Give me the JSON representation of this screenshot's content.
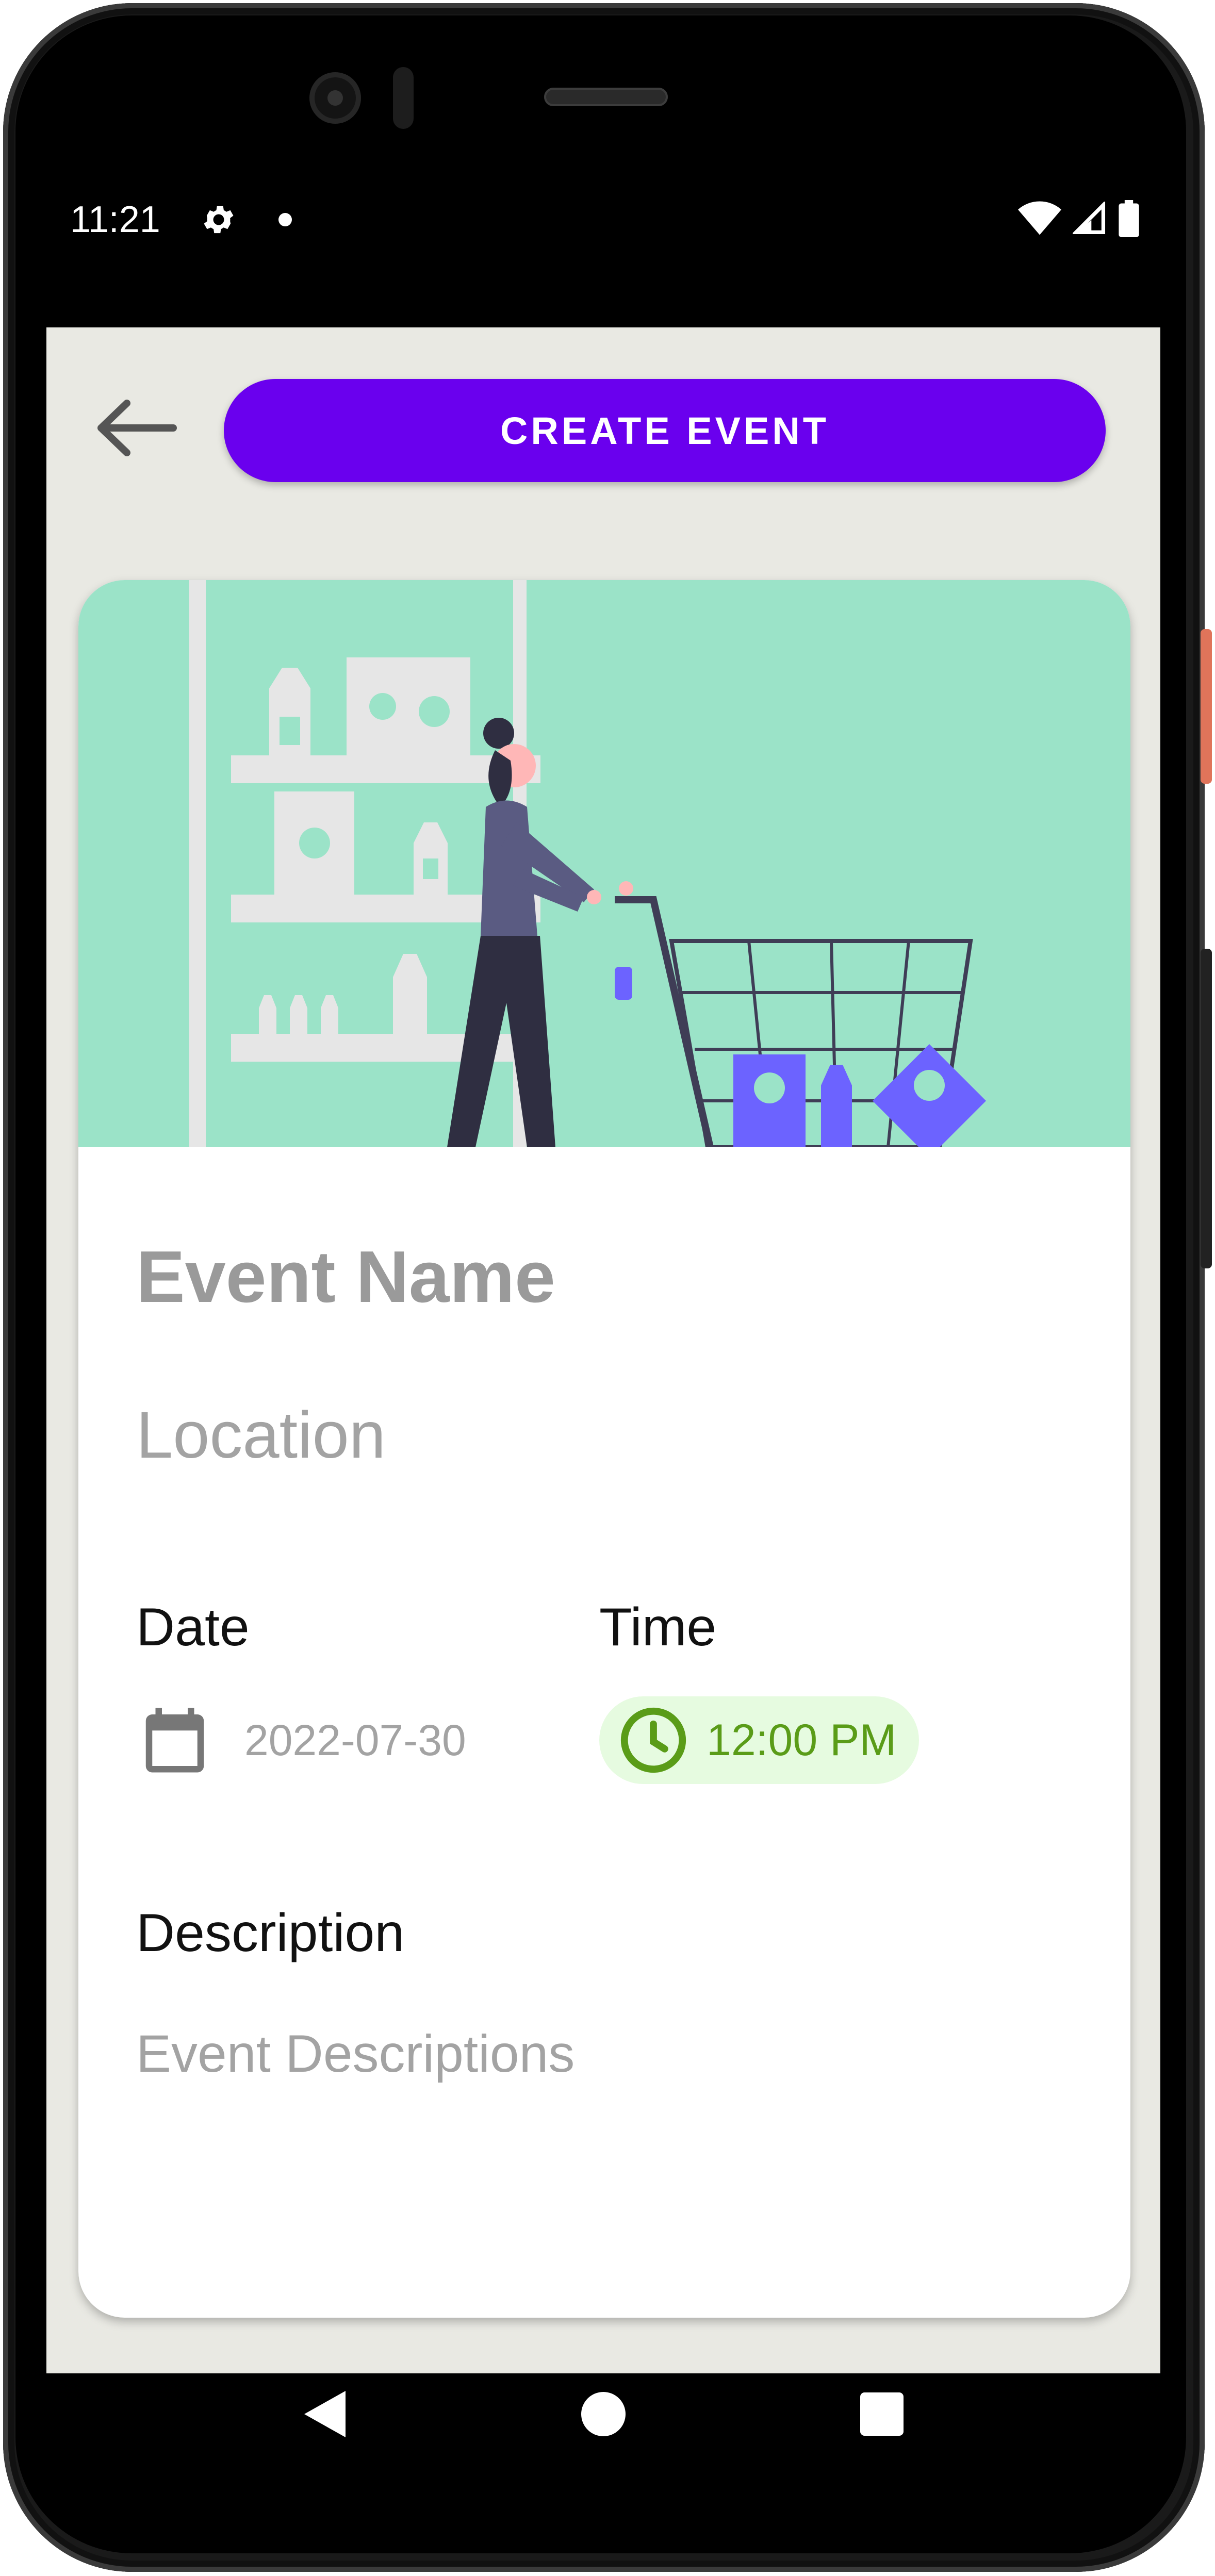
{
  "status_bar": {
    "time": "11:21",
    "icons": [
      "gear-icon",
      "notification-dot-icon",
      "wifi-icon",
      "cellular-signal-icon",
      "battery-icon"
    ]
  },
  "toolbar": {
    "back_icon": "arrow-left-icon",
    "create_label": "CREATE EVENT",
    "create_color": "#6a00ee"
  },
  "card": {
    "hero_image": "shopping-cart-illustration",
    "hero_color": "#9be3c8",
    "event_name_placeholder": "Event Name",
    "location_placeholder": "Location",
    "date_label": "Date",
    "date_icon": "calendar-icon",
    "date_value": "2022-07-30",
    "time_label": "Time",
    "time_icon": "clock-icon",
    "time_value": "12:00 PM",
    "time_color": "#5a9c18",
    "description_label": "Description",
    "description_placeholder": "Event Descriptions"
  },
  "nav_bar": {
    "icons": [
      "nav-back-icon",
      "nav-home-icon",
      "nav-recents-icon"
    ]
  },
  "colors": {
    "background": "#e9e9e3",
    "card": "#ffffff",
    "placeholder_text": "#a3a3a3"
  }
}
